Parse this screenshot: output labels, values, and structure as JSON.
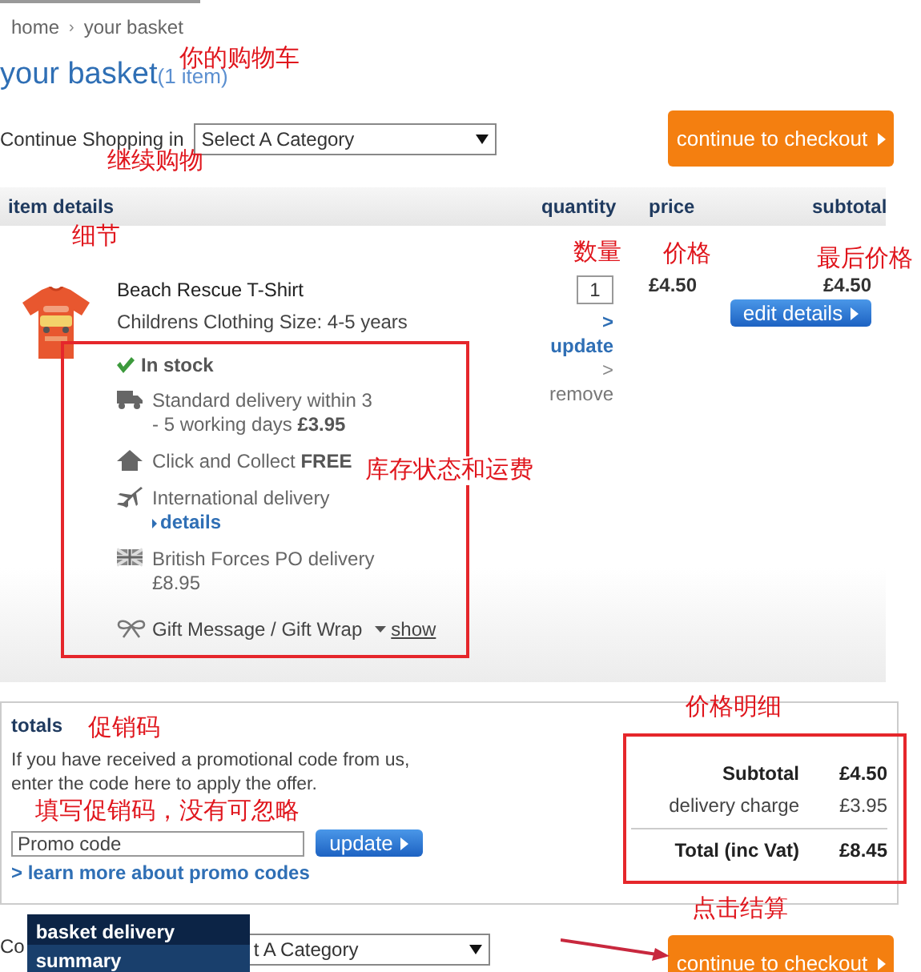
{
  "breadcrumb": {
    "items": [
      "home",
      "your basket"
    ],
    "separator": "›"
  },
  "title": {
    "text": "your basket",
    "count": "(1 item)"
  },
  "continue_shopping": {
    "label": "Continue Shopping in",
    "select": "Select A Category"
  },
  "checkout_button": {
    "label": "continue to checkout"
  },
  "columns": [
    "item details",
    "quantity",
    "price",
    "subtotal"
  ],
  "item": {
    "name": "Beach Rescue T-Shirt",
    "description": "Childrens Clothing Size: 4-5 years",
    "quantity": "1",
    "price": "£4.50",
    "subtotal": "£4.50",
    "edit_button": "edit details",
    "update_link": {
      "arrow": ">",
      "label": "update"
    },
    "remove_link": {
      "arrow": ">",
      "label": "remove"
    },
    "stock": "In stock",
    "delivery": [
      {
        "kind": "truck",
        "lines": [
          "Standard delivery within 3",
          "- 5 working days **£3.95**"
        ]
      },
      {
        "kind": "house",
        "lines": [
          "Click and Collect **FREE**"
        ]
      },
      {
        "kind": "plane",
        "lines": [
          "International delivery"
        ],
        "link": "details"
      },
      {
        "kind": "flag",
        "lines": [
          "British Forces PO delivery",
          "£8.95"
        ]
      }
    ],
    "gift": {
      "label": "Gift Message / Gift Wrap",
      "toggle": "show"
    }
  },
  "totals": {
    "heading": "totals",
    "promo_text": "If you have received a promotional code from us, enter the code here to apply the offer.",
    "promo_field": {
      "placeholder": "Promo code"
    },
    "update_button": "update",
    "learn_more": "> learn more about promo codes",
    "lines": [
      {
        "kind": "subtotal",
        "label": "Subtotal",
        "value": "£4.50"
      },
      {
        "kind": "charge",
        "label": "delivery charge",
        "value": "£3.95"
      },
      {
        "kind": "total",
        "label": "Total  (inc Vat)",
        "value": "£8.45"
      }
    ]
  },
  "bottom_bar": {
    "label": "Co",
    "panel": "basket delivery summary",
    "select": "t A Category",
    "checkout_button": "continue to checkout"
  },
  "annotations": [
    {
      "kind": "note",
      "text": "你的购物车"
    },
    {
      "kind": "note",
      "text": "继续购物"
    },
    {
      "kind": "note",
      "text": "细节"
    },
    {
      "kind": "note",
      "text": "数量"
    },
    {
      "kind": "note",
      "text": "价格"
    },
    {
      "kind": "note",
      "text": "最后价格"
    },
    {
      "kind": "note",
      "text": "库存状态和运费"
    },
    {
      "kind": "note",
      "text": "价格明细"
    },
    {
      "kind": "note",
      "text": "促销码"
    },
    {
      "kind": "note",
      "text": "填写促销码，没有可忽略"
    },
    {
      "kind": "note",
      "text": "点击结算"
    },
    {
      "kind": "box"
    },
    {
      "kind": "box"
    },
    {
      "kind": "arrow"
    }
  ]
}
